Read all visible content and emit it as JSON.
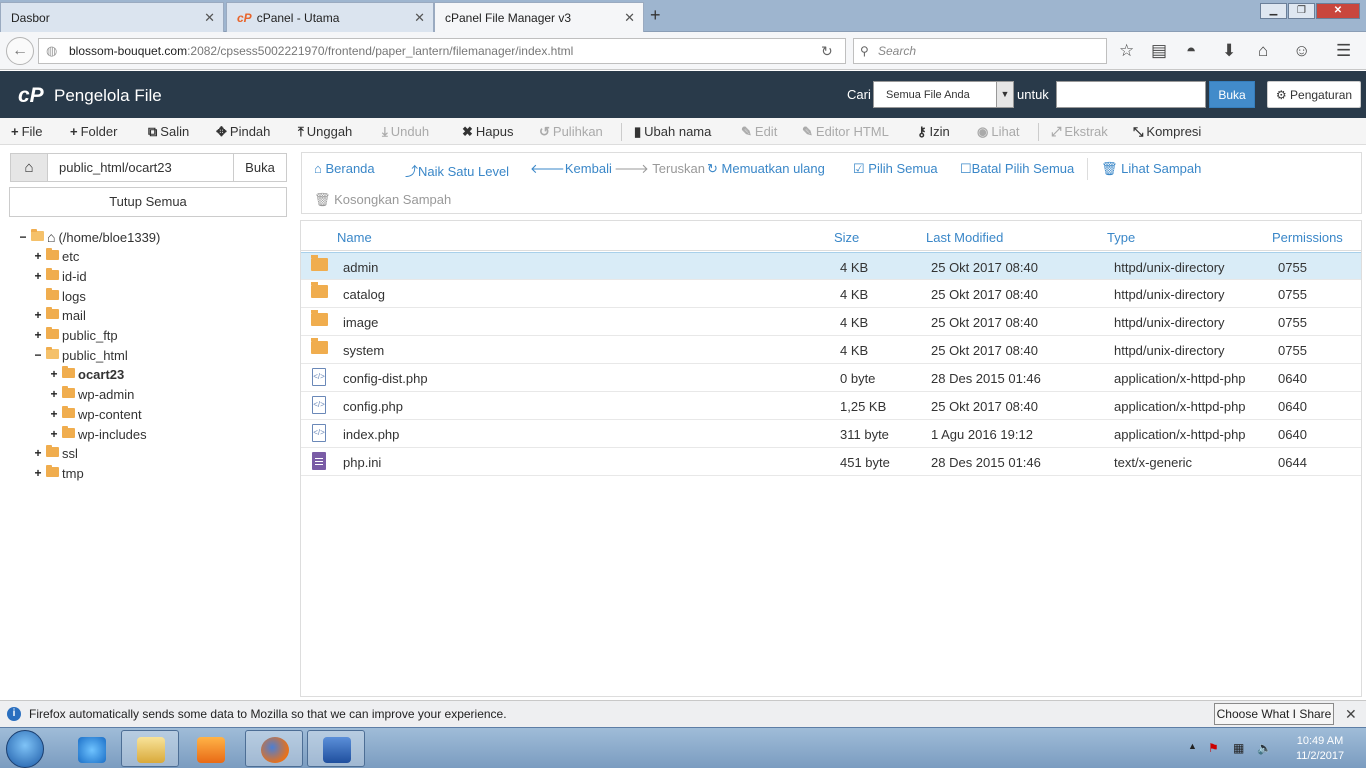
{
  "browser": {
    "tabs": [
      {
        "label": "Dasbor"
      },
      {
        "label": "cPanel - Utama"
      },
      {
        "label": "cPanel File Manager v3"
      }
    ],
    "url_host": "blossom-bouquet.com",
    "url_rest": ":2082/cpsess5002221970/frontend/paper_lantern/filemanager/index.html",
    "search_placeholder": "Search"
  },
  "header": {
    "logo": "cP",
    "title": "Pengelola File",
    "search_label": "Cari",
    "search_scope": "Semua File Anda",
    "for_label": "untuk",
    "go_label": "Buka",
    "settings_label": "Pengaturan"
  },
  "toolbar": {
    "file": "File",
    "folder": "Folder",
    "copy": "Salin",
    "move": "Pindah",
    "upload": "Unggah",
    "download": "Unduh",
    "delete": "Hapus",
    "restore": "Pulihkan",
    "rename": "Ubah nama",
    "edit": "Edit",
    "html_editor": "Editor HTML",
    "permissions": "Izin",
    "view": "Lihat",
    "extract": "Ekstrak",
    "compress": "Kompresi"
  },
  "left": {
    "path_value": "public_html/ocart23",
    "go_label": "Buka",
    "collapse_label": "Tutup Semua",
    "tree": {
      "root": "(/home/bloe1339)",
      "etc": "etc",
      "idid": "id-id",
      "logs": "logs",
      "mail": "mail",
      "public_ftp": "public_ftp",
      "public_html": "public_html",
      "ocart23": "ocart23",
      "wpadmin": "wp-admin",
      "wpcontent": "wp-content",
      "wpincludes": "wp-includes",
      "ssl": "ssl",
      "tmp": "tmp"
    }
  },
  "actions": {
    "home": "Beranda",
    "up": "Naik Satu Level",
    "back": "Kembali",
    "forward": "Teruskan",
    "reload": "Memuatkan ulang",
    "select_all": "Pilih Semua",
    "unselect_all": "Batal Pilih Semua",
    "view_trash": "Lihat Sampah",
    "empty_trash": "Kosongkan Sampah"
  },
  "table": {
    "headers": {
      "name": "Name",
      "size": "Size",
      "modified": "Last Modified",
      "type": "Type",
      "perms": "Permissions"
    },
    "rows": [
      {
        "name": "admin",
        "size": "4 KB",
        "modified": "25 Okt 2017 08:40",
        "type": "httpd/unix-directory",
        "perms": "0755",
        "icon": "folder-icon"
      },
      {
        "name": "catalog",
        "size": "4 KB",
        "modified": "25 Okt 2017 08:40",
        "type": "httpd/unix-directory",
        "perms": "0755",
        "icon": "folder-icon"
      },
      {
        "name": "image",
        "size": "4 KB",
        "modified": "25 Okt 2017 08:40",
        "type": "httpd/unix-directory",
        "perms": "0755",
        "icon": "folder-icon"
      },
      {
        "name": "system",
        "size": "4 KB",
        "modified": "25 Okt 2017 08:40",
        "type": "httpd/unix-directory",
        "perms": "0755",
        "icon": "folder-icon"
      },
      {
        "name": "config-dist.php",
        "size": "0 byte",
        "modified": "28 Des 2015 01:46",
        "type": "application/x-httpd-php",
        "perms": "0640",
        "icon": "php-file-icon"
      },
      {
        "name": "config.php",
        "size": "1,25 KB",
        "modified": "25 Okt 2017 08:40",
        "type": "application/x-httpd-php",
        "perms": "0640",
        "icon": "php-file-icon"
      },
      {
        "name": "index.php",
        "size": "311 byte",
        "modified": "1 Agu 2016 19:12",
        "type": "application/x-httpd-php",
        "perms": "0640",
        "icon": "php-file-icon"
      },
      {
        "name": "php.ini",
        "size": "451 byte",
        "modified": "28 Des 2015 01:46",
        "type": "text/x-generic",
        "perms": "0644",
        "icon": "text-file-icon"
      }
    ]
  },
  "notification": {
    "text": "Firefox automatically sends some data to Mozilla so that we can improve your experience.",
    "button": "Choose What I Share"
  },
  "taskbar": {
    "time": "10:49 AM",
    "date": "11/2/2017"
  },
  "colors": {
    "header_bg": "#293a4a",
    "link_blue": "#3a87c8",
    "folder": "#f0ad4e",
    "selected_row": "#d9ecf7",
    "go_button": "#428bca"
  }
}
